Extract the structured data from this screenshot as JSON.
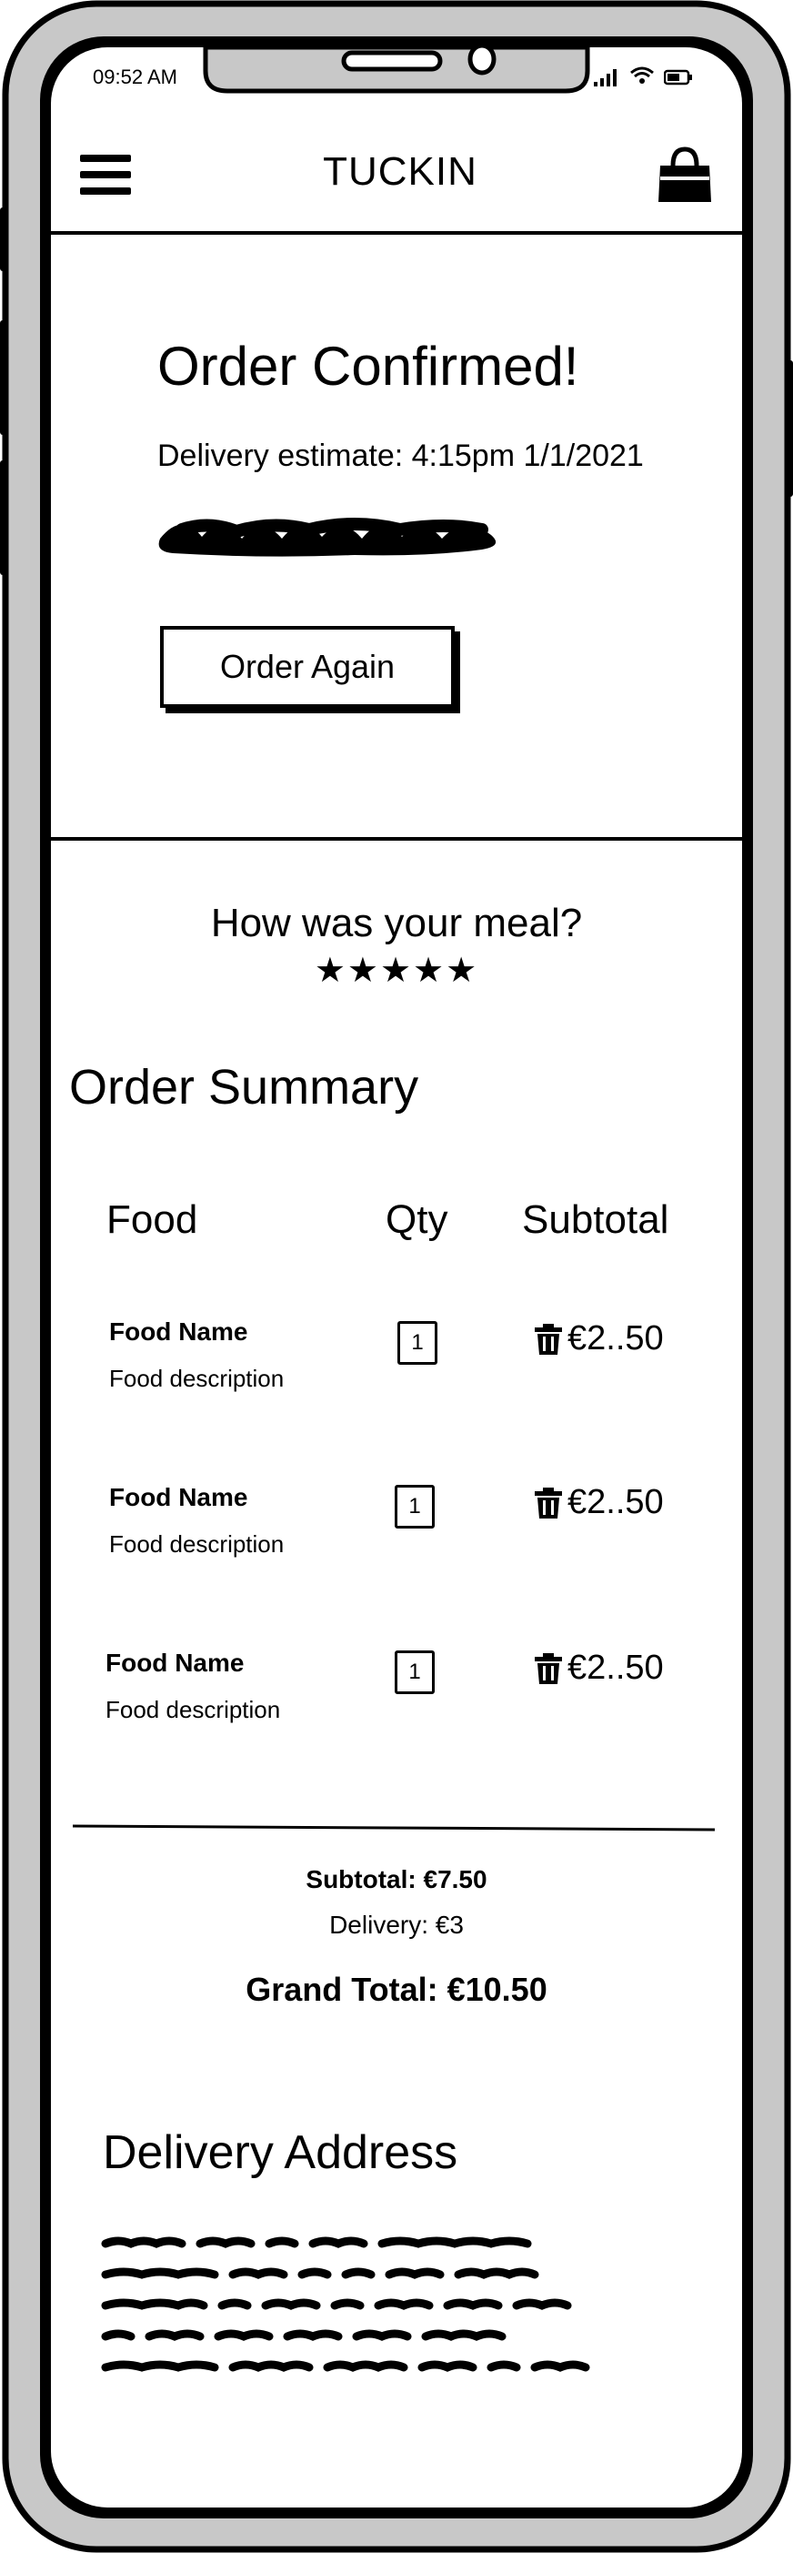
{
  "status_bar": {
    "time": "09:52 AM"
  },
  "header": {
    "brand": "TUCKIN"
  },
  "confirmation": {
    "title": "Order Confirmed!",
    "delivery_estimate": "Delivery estimate: 4:15pm 1/1/2021",
    "order_again_label": "Order Again"
  },
  "rating": {
    "question": "How was your meal?",
    "stars": "★★★★★",
    "value": 5,
    "max": 5
  },
  "order_summary": {
    "title": "Order Summary",
    "columns": [
      "Food",
      "Qty",
      "Subtotal"
    ],
    "items": [
      {
        "name": "Food Name",
        "description": "Food description",
        "qty": "1",
        "subtotal": "€2..50"
      },
      {
        "name": "Food Name",
        "description": "Food description",
        "qty": "1",
        "subtotal": "€2..50"
      },
      {
        "name": "Food Name",
        "description": "Food description",
        "qty": "1",
        "subtotal": "€2..50"
      }
    ]
  },
  "totals": {
    "subtotal": "Subtotal: €7.50",
    "delivery": "Delivery: €3",
    "grand_total": "Grand Total: €10.50"
  },
  "delivery_address": {
    "title": "Delivery Address"
  }
}
